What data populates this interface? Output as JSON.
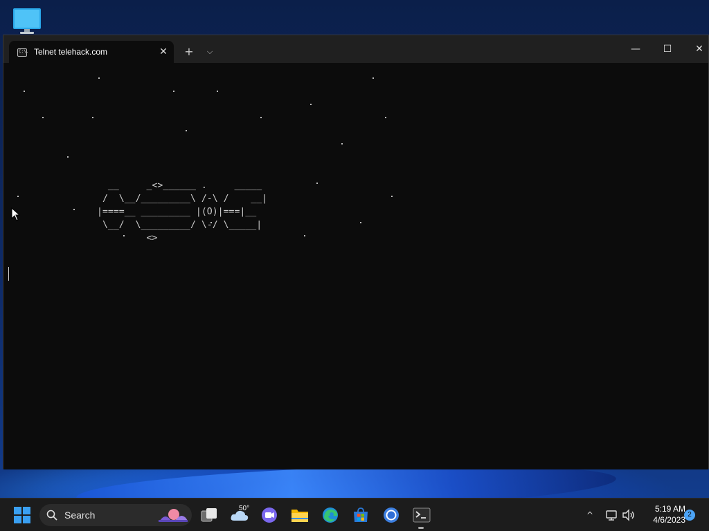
{
  "desktop": {
    "icons": [
      {
        "name": "this-pc",
        "icon": "monitor-icon"
      }
    ]
  },
  "window": {
    "tab": {
      "title": "Telnet telehack.com",
      "icon": "terminal-icon",
      "icon_text": "C:\\."
    },
    "controls": {
      "close_tab": "✕",
      "new_tab": "+",
      "dropdown": "⌵",
      "minimize": "—",
      "maximize": "☐",
      "close": "✕"
    }
  },
  "terminal": {
    "ascii_art": "  __     _<>______ .     _____\n /  \\__/_________\\ /-\\ /    __|\n|====__ _________ |(O)|===|__\n \\__/  \\_________/ \\-/ \\_____|\n         <>"
  },
  "taskbar": {
    "start_icon": "windows-start-icon",
    "search": {
      "placeholder": "Search",
      "icon": "search-icon"
    },
    "apps": [
      {
        "name": "task-view",
        "icon": "task-view-icon"
      },
      {
        "name": "weather",
        "icon": "weather-cloud-icon",
        "label": "50°"
      },
      {
        "name": "teams-chat",
        "icon": "chat-icon"
      },
      {
        "name": "file-explorer",
        "icon": "folder-icon"
      },
      {
        "name": "edge",
        "icon": "edge-icon"
      },
      {
        "name": "store",
        "icon": "store-icon"
      },
      {
        "name": "chrome",
        "icon": "chrome-icon"
      },
      {
        "name": "terminal",
        "icon": "terminal-icon",
        "active": true
      }
    ],
    "tray": {
      "chevron": "^",
      "icons": [
        "network-icon",
        "volume-icon"
      ],
      "time": "5:19 AM",
      "date": "4/6/2023",
      "notifications": "2"
    }
  },
  "colors": {
    "terminal_bg": "#0c0c0c",
    "titlebar_bg": "#202020",
    "taskbar_bg": "#1c1c1c",
    "accent": "#4ca3f5"
  }
}
